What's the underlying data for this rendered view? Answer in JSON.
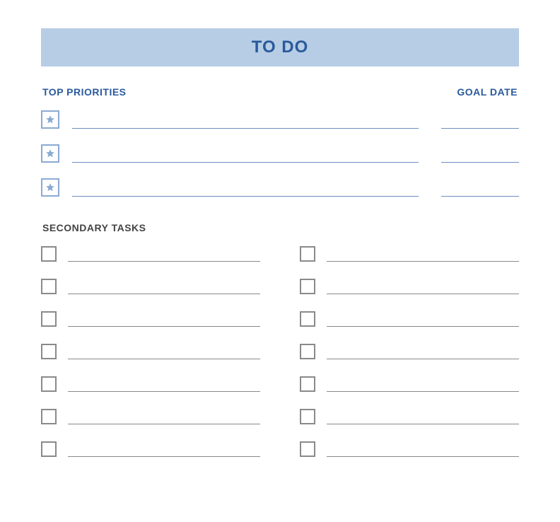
{
  "header": {
    "title": "TO DO"
  },
  "priorities": {
    "label": "TOP PRIORITIES",
    "goal_date_label": "GOAL DATE",
    "rows": [
      {
        "task": "",
        "goal_date": ""
      },
      {
        "task": "",
        "goal_date": ""
      },
      {
        "task": "",
        "goal_date": ""
      }
    ]
  },
  "secondary": {
    "label": "SECONDARY TASKS",
    "left": [
      {
        "task": ""
      },
      {
        "task": ""
      },
      {
        "task": ""
      },
      {
        "task": ""
      },
      {
        "task": ""
      },
      {
        "task": ""
      },
      {
        "task": ""
      }
    ],
    "right": [
      {
        "task": ""
      },
      {
        "task": ""
      },
      {
        "task": ""
      },
      {
        "task": ""
      },
      {
        "task": ""
      },
      {
        "task": ""
      },
      {
        "task": ""
      }
    ]
  },
  "colors": {
    "header_bg": "#B7CDE5",
    "accent": "#2A5A9C",
    "priority_line": "#6B8FBF",
    "secondary_line": "#8a8a8a"
  }
}
